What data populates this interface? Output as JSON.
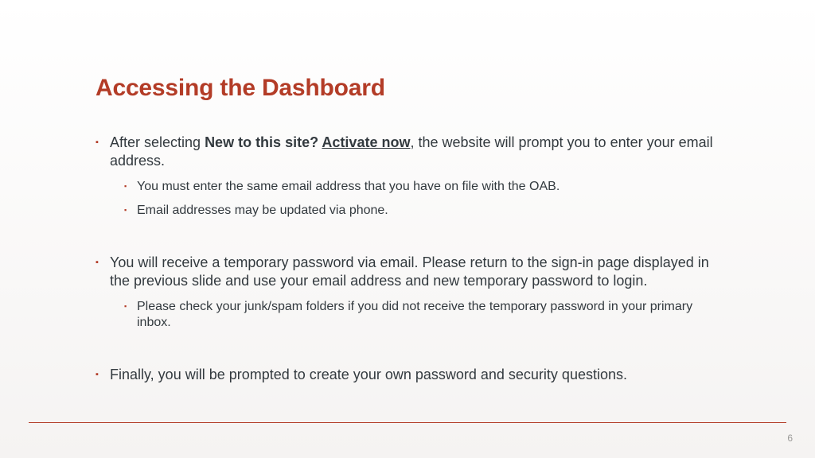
{
  "title": "Accessing the Dashboard",
  "bullets": {
    "b1": {
      "pre": "After selecting ",
      "bold_prefix": "New to this site? ",
      "bold_ul": "Activate now",
      "post": ", the website will prompt you to enter your email address.",
      "sub1": "You must enter the same email address that you have on file with the OAB.",
      "sub2": "Email addresses may be updated via phone."
    },
    "b2": {
      "text": "You will receive a temporary password via email. Please return to the sign-in page displayed in the previous slide and use your email address and new temporary password to login.",
      "sub1": "Please check your junk/spam folders if you did not receive the temporary password in your primary inbox."
    },
    "b3": {
      "text": "Finally, you will be prompted to create your own password and security questions."
    }
  },
  "page_number": "6"
}
